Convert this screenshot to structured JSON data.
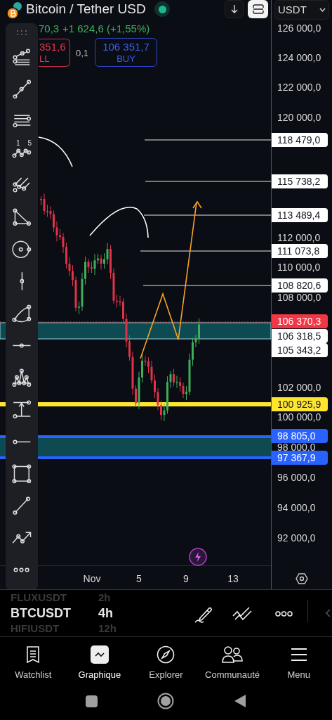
{
  "header": {
    "title": "Bitcoin / Tether USD",
    "live": true,
    "last_price_partial": "70,3",
    "change": "+1 624,6 (+1,55%)"
  },
  "trade": {
    "sell_price": "351,6",
    "sell_label": "LL",
    "quantity": "0,1",
    "buy_price": "106 351,7",
    "buy_label": "BUY"
  },
  "currency": "USDT",
  "price_axis": {
    "ticks": [
      "126 000,0",
      "124 000,0",
      "122 000,0",
      "120 000,0",
      "112 000,0",
      "110 000,0",
      "108 000,0",
      "102 000,0",
      "100 000,0",
      "98 000,0",
      "96 000,0",
      "94 000,0",
      "92 000,0"
    ]
  },
  "price_tags": [
    {
      "label": "118 479,0",
      "color": "#ffffff"
    },
    {
      "label": "115 738,2",
      "color": "#ffffff"
    },
    {
      "label": "113 489,4",
      "color": "#ffffff"
    },
    {
      "label": "111 073,8",
      "color": "#ffffff"
    },
    {
      "label": "108 820,6",
      "color": "#ffffff"
    },
    {
      "label": "106 370,3",
      "color": "#f23645"
    },
    {
      "label": "106 318,5",
      "color": "#ffffff"
    },
    {
      "label": "105 343,2",
      "color": "#ffffff"
    },
    {
      "label": "100 925,9",
      "color": "#ffe62e"
    },
    {
      "label": "98 805,0",
      "color": "#2962ff"
    },
    {
      "label": "97 367,9",
      "color": "#2962ff"
    }
  ],
  "time_axis": [
    "Nov",
    "5",
    "9",
    "13"
  ],
  "drawing_tools": [
    {
      "kind": "fib"
    },
    {
      "kind": "trend"
    },
    {
      "kind": "hlines"
    },
    {
      "kind": "wave",
      "labels": [
        "1",
        "5"
      ]
    },
    {
      "kind": "pitchfork"
    },
    {
      "kind": "triangle"
    },
    {
      "kind": "circle"
    },
    {
      "kind": "vnode"
    },
    {
      "kind": "curve"
    },
    {
      "kind": "hnode"
    },
    {
      "kind": "pattern"
    },
    {
      "kind": "measure"
    },
    {
      "kind": "ray"
    },
    {
      "kind": "rect"
    },
    {
      "kind": "line"
    },
    {
      "kind": "path"
    },
    {
      "kind": "more"
    }
  ],
  "watchlist": [
    {
      "symbol": "FLUXUSDT",
      "interval": "2h",
      "selected": false
    },
    {
      "symbol": "BTCUSDT",
      "interval": "4h",
      "selected": true
    },
    {
      "symbol": "HIFIUSDT",
      "interval": "12h",
      "selected": false
    }
  ],
  "nav": [
    {
      "label": "Watchlist",
      "kind": "watchlist",
      "selected": false
    },
    {
      "label": "Graphique",
      "kind": "chart",
      "selected": true
    },
    {
      "label": "Explorer",
      "kind": "compass",
      "selected": false
    },
    {
      "label": "Communauté",
      "kind": "people",
      "selected": false
    },
    {
      "label": "Menu",
      "kind": "menu",
      "selected": false
    }
  ]
}
